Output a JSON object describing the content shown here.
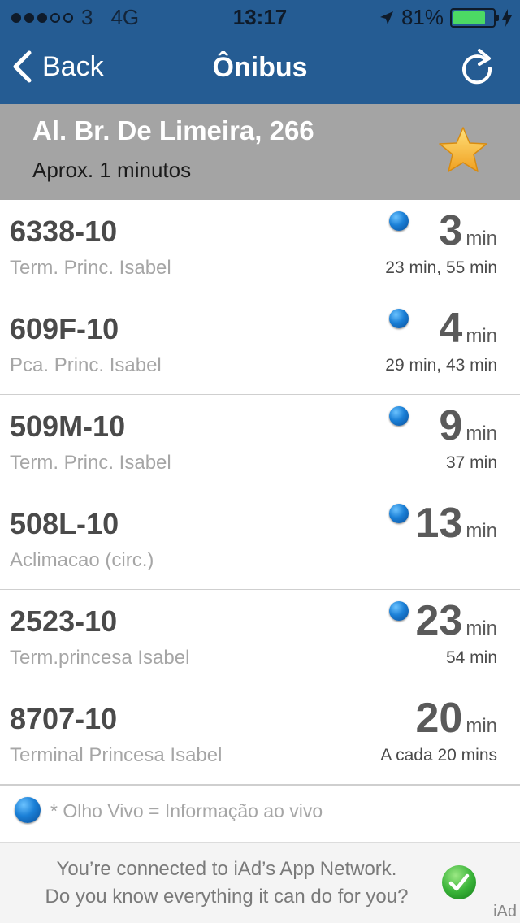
{
  "status_bar": {
    "carrier": "3",
    "network": "4G",
    "time": "13:17",
    "battery": "81%",
    "battery_level": 0.81,
    "battery_color": "#4cd964"
  },
  "nav": {
    "back_label": "Back",
    "title": "Ônibus",
    "refresh_icon": "refresh-icon"
  },
  "stop": {
    "name": "Al. Br. De Limeira, 266",
    "approx": "Aprox. 1 minutos",
    "favorite_icon": "star-icon"
  },
  "buses": [
    {
      "code": "6338-10",
      "destination": "Term. Princ. Isabel",
      "live": true,
      "eta": "3",
      "unit": "min",
      "next": "23 min, 55 min"
    },
    {
      "code": "609F-10",
      "destination": "Pca. Princ. Isabel",
      "live": true,
      "eta": "4",
      "unit": "min",
      "next": "29 min, 43 min"
    },
    {
      "code": "509M-10",
      "destination": "Term. Princ. Isabel",
      "live": true,
      "eta": "9",
      "unit": "min",
      "next": "37 min"
    },
    {
      "code": "508L-10",
      "destination": "Aclimacao (circ.)",
      "live": true,
      "eta": "13",
      "unit": "min",
      "next": ""
    },
    {
      "code": "2523-10",
      "destination": "Term.princesa Isabel",
      "live": true,
      "eta": "23",
      "unit": "min",
      "next": "54 min"
    },
    {
      "code": "8707-10",
      "destination": "Terminal Princesa Isabel",
      "live": false,
      "eta": "20",
      "unit": "min",
      "next": "A cada 20 mins"
    }
  ],
  "legend": {
    "text": "* Olho Vivo = Informação ao vivo"
  },
  "ad": {
    "line1": "You’re connected to iAd’s App Network.",
    "line2": "Do you know everything it can do for you?",
    "label": "iAd"
  },
  "colors": {
    "nav_bg": "#255c93",
    "header_bg": "#a4a4a4",
    "live_dot": "#1a7fd6"
  }
}
